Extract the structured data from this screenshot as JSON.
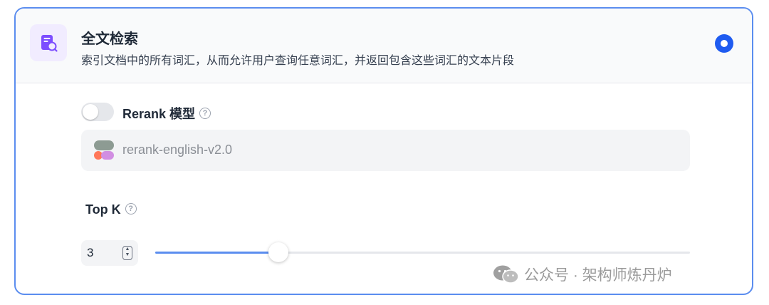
{
  "retrieval": {
    "title": "全文检索",
    "description": "索引文档中的所有词汇，从而允许用户查询任意词汇，并返回包含这些词汇的文本片段",
    "selected": true,
    "icon": "document-search-icon"
  },
  "rerank": {
    "label": "Rerank 模型",
    "enabled": false,
    "help_icon": "question-circle-icon",
    "model_name": "rerank-english-v2.0",
    "model_icon": "cohere-logo-icon"
  },
  "topk": {
    "label": "Top K",
    "value": "3",
    "slider_fraction": 0.23,
    "help_icon": "question-circle-icon"
  },
  "watermark": {
    "text": "公众号 · 架构师炼丹炉",
    "icon": "wechat-icon"
  },
  "colors": {
    "accent": "#1f5bf0",
    "border": "#5b8def",
    "icon_purple": "#7c4dff"
  }
}
